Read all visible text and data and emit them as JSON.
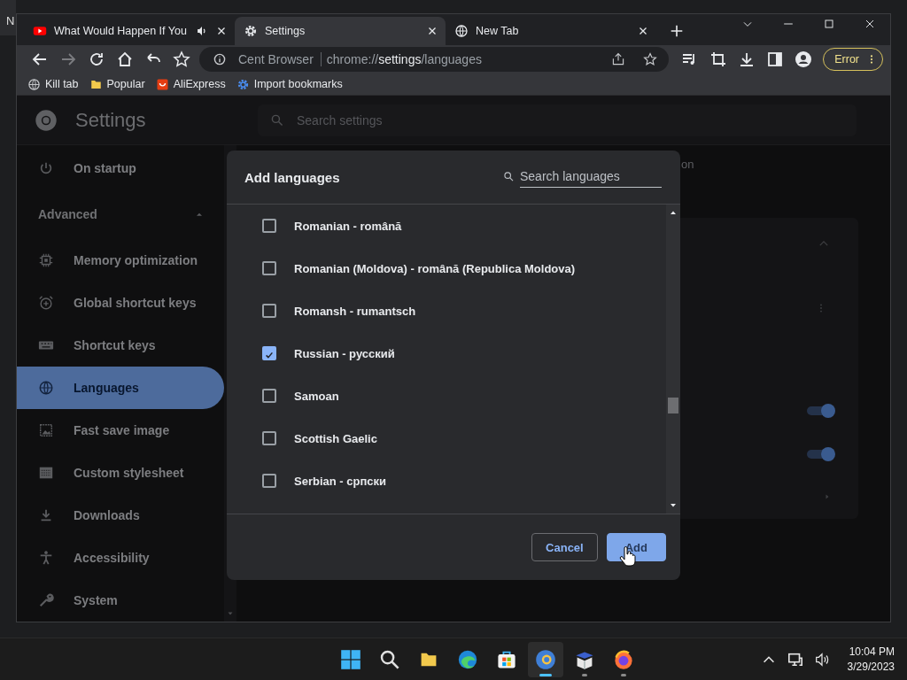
{
  "background_window": {
    "title": "N"
  },
  "browser": {
    "tabs": [
      {
        "title": "What Would Happen If You",
        "kind": "video",
        "audio": true,
        "selected": false
      },
      {
        "title": "Settings",
        "kind": "gear",
        "audio": false,
        "selected": true
      },
      {
        "title": "New Tab",
        "kind": "globe",
        "audio": false,
        "selected": false
      }
    ],
    "address": {
      "site": "Cent Browser",
      "scheme": "chrome://",
      "host": "settings",
      "path": "/languages"
    },
    "profile_button": "Error",
    "bookmarks": [
      {
        "label": "Kill tab",
        "kind": "globe"
      },
      {
        "label": "Popular",
        "kind": "folder"
      },
      {
        "label": "AliExpress",
        "kind": "bag"
      },
      {
        "label": "Import bookmarks",
        "kind": "gear"
      }
    ]
  },
  "settings": {
    "title": "Settings",
    "search": {
      "placeholder": "Search settings"
    },
    "sidebar": {
      "top_items": [
        {
          "label": "On startup",
          "kind": "power",
          "selected": false
        }
      ],
      "advanced": {
        "label": "Advanced",
        "expanded": true,
        "items": [
          {
            "label": "Memory optimization",
            "kind": "chip",
            "selected": false
          },
          {
            "label": "Global shortcut keys",
            "kind": "alarm",
            "selected": false
          },
          {
            "label": "Shortcut keys",
            "kind": "keyboard",
            "selected": false
          },
          {
            "label": "Languages",
            "kind": "globe",
            "selected": true
          },
          {
            "label": "Fast save image",
            "kind": "image",
            "selected": false
          },
          {
            "label": "Custom stylesheet",
            "kind": "grid",
            "selected": false
          },
          {
            "label": "Downloads",
            "kind": "download",
            "selected": false
          },
          {
            "label": "Accessibility",
            "kind": "person",
            "selected": false
          },
          {
            "label": "System",
            "kind": "wrench",
            "selected": false
          }
        ]
      }
    },
    "page_text": "on",
    "toggles": [
      {
        "on": true
      },
      {
        "on": true
      }
    ]
  },
  "dialog": {
    "title": "Add languages",
    "search": {
      "placeholder": "Search languages"
    },
    "languages": [
      {
        "label": "Romanian - română",
        "checked": false
      },
      {
        "label": "Romanian (Moldova) - română (Republica Moldova)",
        "checked": false
      },
      {
        "label": "Romansh - rumantsch",
        "checked": false
      },
      {
        "label": "Russian - русский",
        "checked": true
      },
      {
        "label": "Samoan",
        "checked": false
      },
      {
        "label": "Scottish Gaelic",
        "checked": false
      },
      {
        "label": "Serbian - српски",
        "checked": false
      }
    ],
    "buttons": [
      {
        "label": "Cancel",
        "kind": "secondary"
      },
      {
        "label": "Add",
        "kind": "primary"
      }
    ]
  },
  "taskbar": {
    "apps": [
      {
        "kind": "start",
        "selected": false,
        "running": false
      },
      {
        "kind": "search",
        "selected": false,
        "running": false
      },
      {
        "kind": "folder",
        "selected": false,
        "running": false
      },
      {
        "kind": "edge",
        "selected": false,
        "running": false
      },
      {
        "kind": "store",
        "selected": false,
        "running": false
      },
      {
        "kind": "cent",
        "selected": true,
        "running": true
      },
      {
        "kind": "box",
        "selected": false,
        "running": true
      },
      {
        "kind": "firefox",
        "selected": false,
        "running": true
      }
    ],
    "time": "10:04 PM",
    "date": "3/29/2023"
  }
}
